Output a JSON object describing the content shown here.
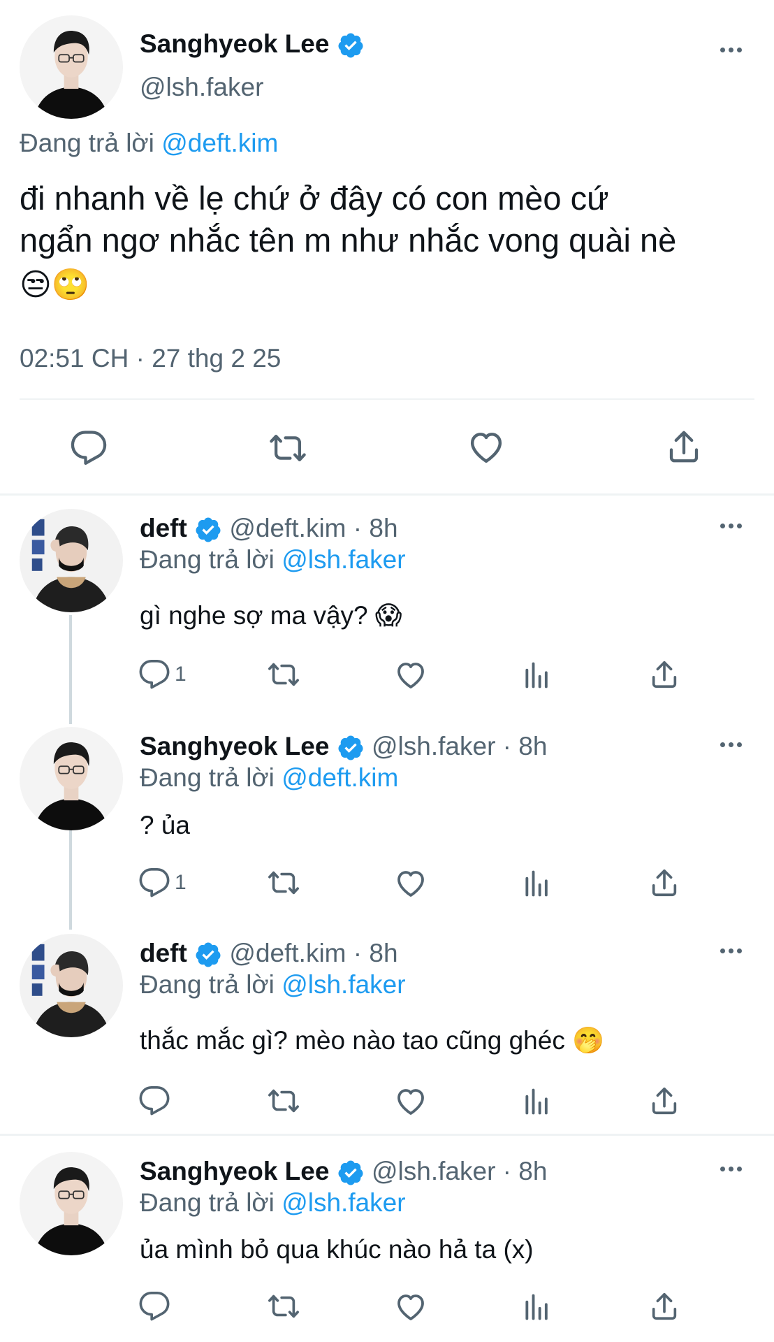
{
  "main_tweet": {
    "display_name": "Sanghyeok Lee",
    "handle": "@lsh.faker",
    "replying_label": "Đang trả lời",
    "replying_to": "@deft.kim",
    "text_line1": "đi nhanh về lẹ chứ ở đây có con mèo cứ",
    "text_line2": "ngẩn ngơ nhắc tên m như nhắc vong quài nè",
    "text_emojis": "😒🙄",
    "timestamp": "02:51 CH · 27 thg 2 25"
  },
  "replies": [
    {
      "display_name": "deft",
      "handle": "@deft.kim",
      "time": " · 8h",
      "replying_label": "Đang trả lời",
      "replying_to": "@lsh.faker",
      "text": "gì nghe sợ ma vậy? 😱",
      "reply_count": "1"
    },
    {
      "display_name": "Sanghyeok Lee",
      "handle": "@lsh.faker",
      "time": " · 8h",
      "replying_label": "Đang trả lời",
      "replying_to": "@deft.kim",
      "text": "? ủa",
      "reply_count": "1"
    },
    {
      "display_name": "deft",
      "handle": "@deft.kim",
      "time": " · 8h",
      "replying_label": "Đang trả lời",
      "replying_to": "@lsh.faker",
      "text": "thắc mắc gì? mèo nào tao cũng ghéc 🤭",
      "reply_count": ""
    },
    {
      "display_name": "Sanghyeok Lee",
      "handle": "@lsh.faker",
      "time": " · 8h",
      "replying_label": "Đang trả lời",
      "replying_to": "@lsh.faker",
      "text": "ủa mình bỏ qua khúc nào hả ta (x)",
      "reply_count": ""
    }
  ],
  "icons": {
    "reply": "reply-icon",
    "retweet": "retweet-icon",
    "like": "like-icon",
    "views": "views-icon",
    "share": "share-icon",
    "more": "more-icon",
    "verified": "verified-badge-icon"
  },
  "colors": {
    "accent": "#1d9bf0",
    "text": "#0f1419",
    "muted": "#536471",
    "divider": "#eff3f4"
  }
}
